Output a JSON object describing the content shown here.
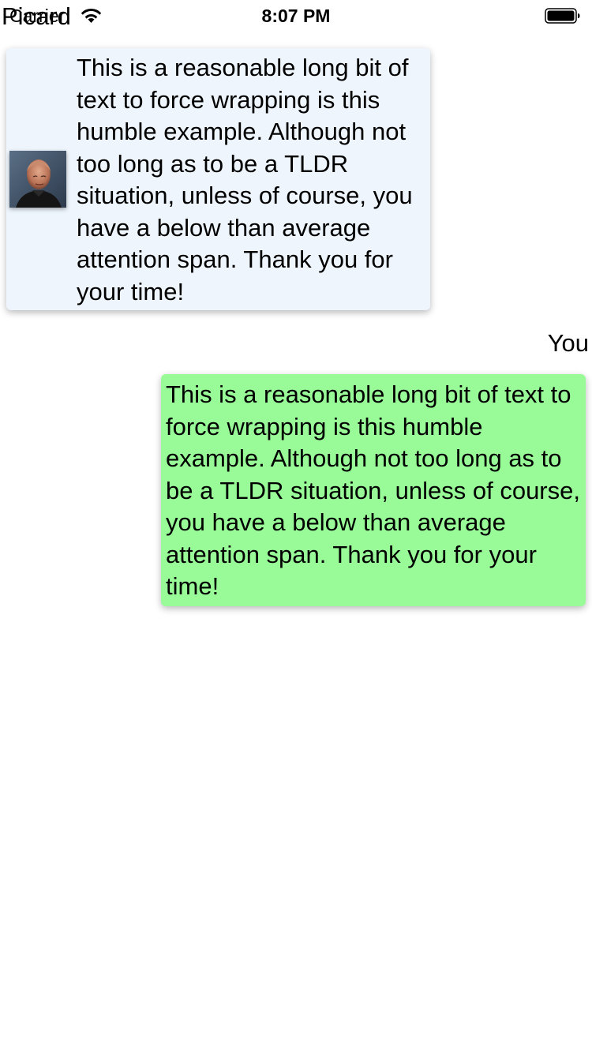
{
  "status_bar": {
    "carrier": "Carrier",
    "time": "8:07 PM",
    "wifi_icon": "wifi-icon",
    "battery_icon": "battery-full-icon"
  },
  "messages": [
    {
      "sender": "Picard",
      "direction": "incoming",
      "avatar": "picard-avatar",
      "bubble_color": "#eef5fd",
      "text": "This is a reasonable long bit of text to force wrapping is this humble example. Although not too long as to be a TLDR situation, unless of course, you have a below than average attention span. Thank you for your time!"
    },
    {
      "sender": "You",
      "direction": "outgoing",
      "bubble_color": "#98fb98",
      "text": "This is a reasonable long bit of text to force wrapping is this humble example. Although not too long as to be a TLDR situation, unless of course, you have a below than average attention span. Thank you for your time!"
    }
  ]
}
